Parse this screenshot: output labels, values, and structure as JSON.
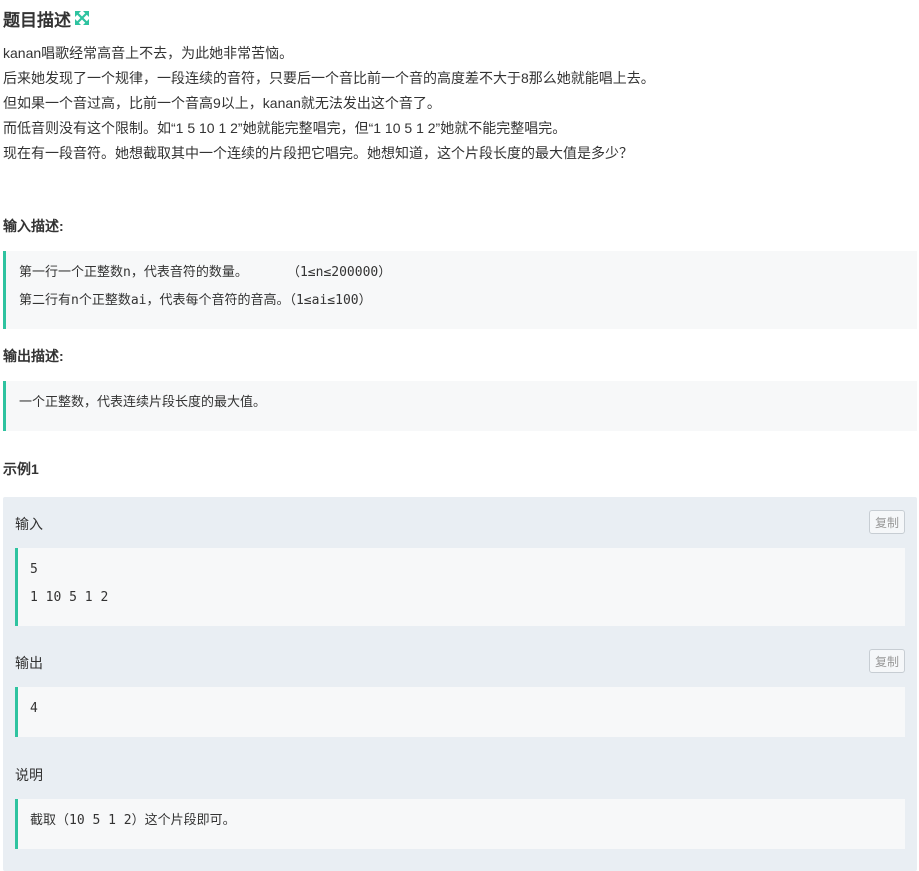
{
  "header": {
    "title": "题目描述",
    "expand_icon": "expand-arrows-icon",
    "accent_color": "#2ec3a0"
  },
  "description": {
    "lines": [
      "kanan唱歌经常高音上不去，为此她非常苦恼。",
      "后来她发现了一个规律，一段连续的音符，只要后一个音比前一个音的高度差不大于8那么她就能唱上去。",
      "但如果一个音过高，比前一个音高9以上，kanan就无法发出这个音了。",
      "而低音则没有这个限制。如“1 5 10 1 2”她就能完整唱完，但“1 10 5 1 2”她就不能完整唱完。",
      "现在有一段音符。她想截取其中一个连续的片段把它唱完。她想知道，这个片段长度的最大值是多少？"
    ]
  },
  "input_desc": {
    "label": "输入描述:",
    "lines": [
      "第一行一个正整数n，代表音符的数量。     （1≤n≤200000）",
      "第二行有n个正整数ai，代表每个音符的音高。（1≤ai≤100）"
    ]
  },
  "output_desc": {
    "label": "输出描述:",
    "lines": [
      "一个正整数，代表连续片段长度的最大值。"
    ]
  },
  "example": {
    "title": "示例1",
    "input_label": "输入",
    "input_lines": [
      "5",
      "1 10 5 1 2"
    ],
    "output_label": "输出",
    "output_lines": [
      "4"
    ],
    "copy_label": "复制",
    "explain_label": "说明",
    "explain_lines": [
      "截取（10 5 1 2）这个片段即可。"
    ]
  }
}
